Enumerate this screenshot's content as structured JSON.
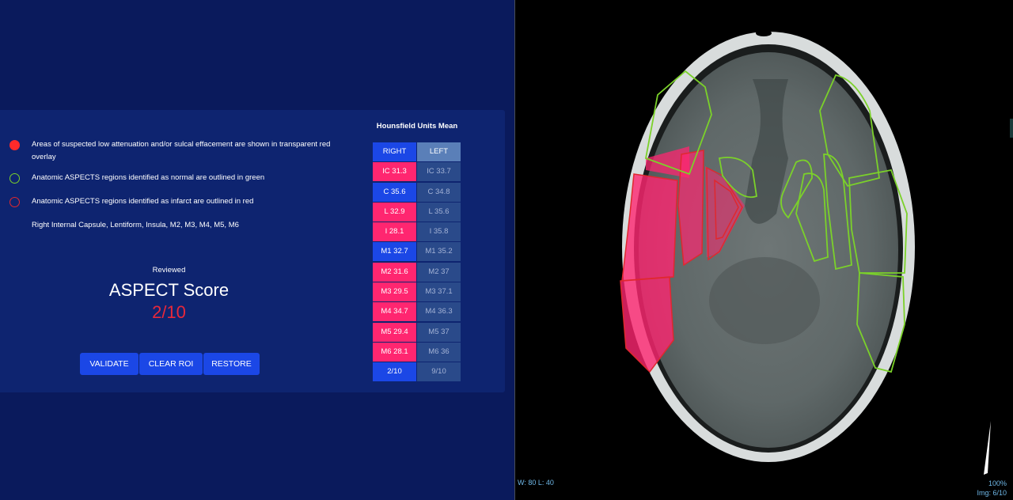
{
  "legend": {
    "items": [
      {
        "text": "Areas of suspected low attenuation and/or sulcal effacement are shown in transparent red overlay",
        "icon": "red-filled-dot-icon"
      },
      {
        "text": "Anatomic ASPECTS regions identified as normal are outlined in green",
        "icon": "green-ring-icon"
      },
      {
        "text": "Anatomic ASPECTS regions identified as infarct are outlined in red",
        "icon": "red-ring-icon"
      }
    ],
    "infarct_regions": "Right Internal Capsule, Lentiform, Insula, M2, M3, M4, M5, M6"
  },
  "score": {
    "reviewed_label": "Reviewed",
    "title": "ASPECT Score",
    "value": "2/10"
  },
  "buttons": {
    "validate": "VALIDATE",
    "clear_roi": "CLEAR ROI",
    "restore": "RESTORE"
  },
  "hu_table": {
    "title": "Hounsfield Units Mean",
    "headers": {
      "right": "RIGHT",
      "left": "LEFT"
    },
    "rows": [
      {
        "right": "IC 31.3",
        "left": "IC 33.7",
        "right_state": "infarct"
      },
      {
        "right": "C 35.6",
        "left": "C 34.8",
        "right_state": "normal"
      },
      {
        "right": "L 32.9",
        "left": "L 35.6",
        "right_state": "infarct"
      },
      {
        "right": "I 28.1",
        "left": "I 35.8",
        "right_state": "infarct"
      },
      {
        "right": "M1 32.7",
        "left": "M1 35.2",
        "right_state": "normal"
      },
      {
        "right": "M2 31.6",
        "left": "M2 37",
        "right_state": "infarct"
      },
      {
        "right": "M3 29.5",
        "left": "M3 37.1",
        "right_state": "infarct"
      },
      {
        "right": "M4 34.7",
        "left": "M4 36.3",
        "right_state": "infarct"
      },
      {
        "right": "M5 29.4",
        "left": "M5 37",
        "right_state": "infarct"
      },
      {
        "right": "M6 28.1",
        "left": "M6 36",
        "right_state": "infarct"
      },
      {
        "right": "2/10",
        "left": "9/10",
        "right_state": "normal"
      }
    ]
  },
  "viewer": {
    "window_level": "W: 80 L: 40",
    "zoom": "100%",
    "image_index": "Img: 6/10"
  },
  "colors": {
    "infarct": "#ff2670",
    "normal_region": "#7bd12a",
    "infarct_outline": "#e0282e",
    "accent": "#1b47e6"
  }
}
